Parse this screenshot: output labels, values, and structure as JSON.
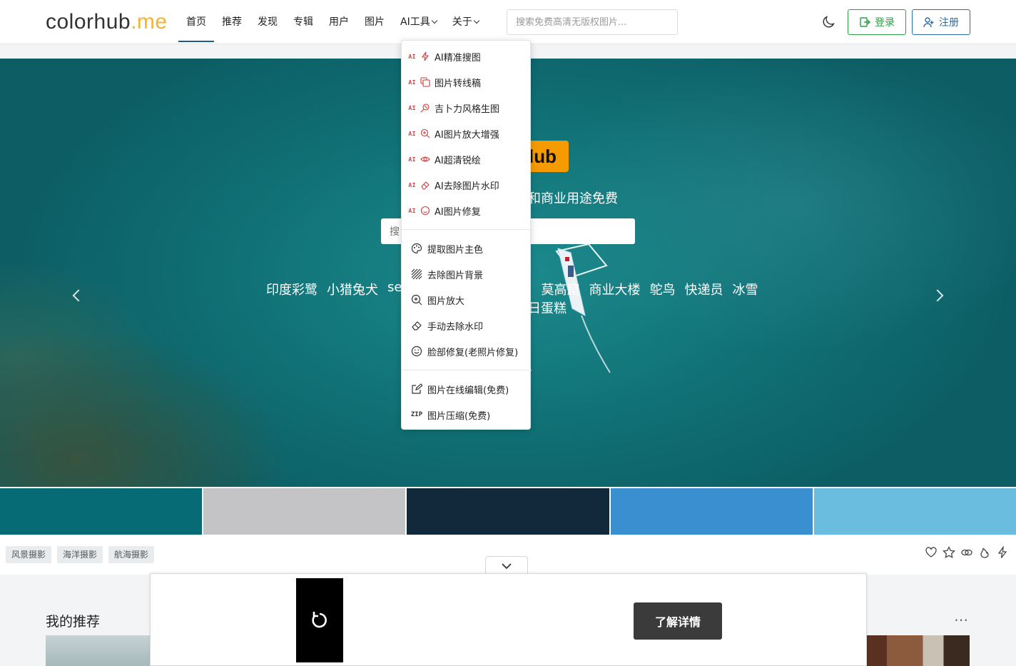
{
  "header": {
    "logo_main": "colorhub",
    "logo_suffix": ".me",
    "nav": [
      "首页",
      "推荐",
      "发现",
      "专辑",
      "用户",
      "图片"
    ],
    "nav_ai_tools": "AI工具",
    "nav_about": "关于",
    "search_placeholder": "搜索免费高清无版权图片...",
    "login_label": "登录",
    "register_label": "注册"
  },
  "hero": {
    "badge": "lub",
    "tagline_pre": "",
    "tagline": "和商业用途免费",
    "search_placeholder": "搜",
    "hot_keywords": [
      "印度彩鹭",
      "小猎兔犬",
      "se",
      "莫高窟",
      "商业大楼",
      "鸵鸟",
      "快递员",
      "冰雪"
    ],
    "hot_keywords_row2": "日蛋糕"
  },
  "dropdown": {
    "ai_tag": "AI",
    "ai_items": [
      "AI精准搜图",
      "图片转线稿",
      "吉卜力风格生图",
      "AI图片放大增强",
      "AI超清锐绘",
      "AI去除图片水印",
      "AI图片修复"
    ],
    "tool_items": [
      "提取图片主色",
      "去除图片背景",
      "图片放大",
      "手动去除水印",
      "脸部修复(老照片修复)"
    ],
    "free_items": [
      "图片在线编辑(免费)",
      "图片压缩(免费)"
    ],
    "zip_label": "ZIP"
  },
  "swatches": [
    "#066b74",
    "#c4c4c6",
    "#11293a",
    "#3a8fd0",
    "#6bbde0"
  ],
  "tags": [
    "风景摄影",
    "海洋摄影",
    "航海摄影"
  ],
  "section": {
    "title": "我的推荐",
    "more": "⋯"
  },
  "ad": {
    "cta_label": "了解详情"
  }
}
